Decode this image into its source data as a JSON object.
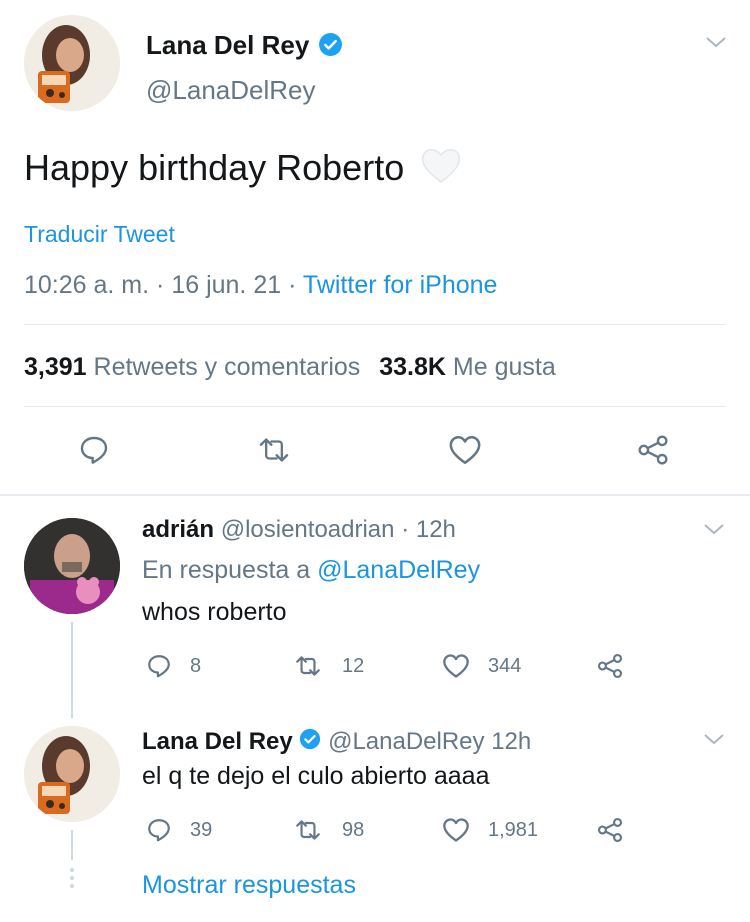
{
  "main_tweet": {
    "author_name": "Lana Del Rey",
    "author_handle": "@LanaDelRey",
    "text": "Happy birthday Roberto",
    "translate_label": "Traducir Tweet",
    "time": "10:26 a. m.",
    "sep1": "·",
    "date": "16 jun. 21",
    "sep2": "·",
    "source": "Twitter for iPhone",
    "retweets_count": "3,391",
    "retweets_label": "Retweets y comentarios",
    "likes_count": "33.8K",
    "likes_label": "Me gusta"
  },
  "reply1": {
    "author_name": "adrián",
    "author_handle": "@losientoadrian",
    "sep": "·",
    "time": "12h",
    "reply_prefix": "En respuesta a",
    "reply_to": "@LanaDelRey",
    "text": "whos roberto",
    "replies": "8",
    "retweets": "12",
    "likes": "344"
  },
  "reply2": {
    "author_name": "Lana Del Rey",
    "author_handle": "@LanaDelRey",
    "time": "12h",
    "text": "el q te dejo el culo abierto aaaa",
    "replies": "39",
    "retweets": "98",
    "likes": "1,981"
  },
  "show_replies_label": "Mostrar respuestas",
  "icons": {
    "verified": "verified-badge-icon",
    "reply": "reply-icon",
    "retweet": "retweet-icon",
    "like": "heart-icon",
    "share": "share-icon",
    "chevron": "chevron-down-icon",
    "emoji": "white-heart-emoji"
  },
  "colors": {
    "accent": "#1b95e0",
    "text": "#14171a",
    "secondary": "#657786",
    "divider": "#e6ecf0"
  }
}
